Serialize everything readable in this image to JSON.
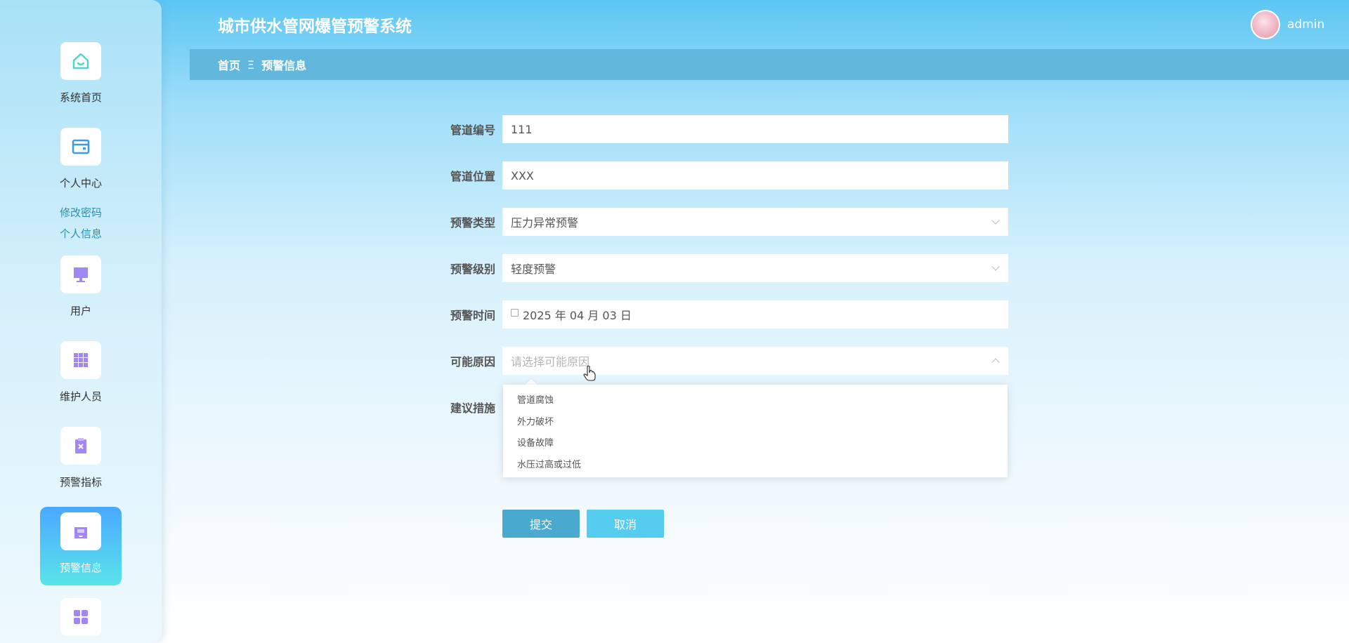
{
  "app": {
    "title": "城市供水管网爆管预警系统"
  },
  "user": {
    "name": "admin"
  },
  "breadcrumb": {
    "home": "首页",
    "separator": "Ξ",
    "current": "预警信息"
  },
  "sidebar": {
    "items": [
      {
        "label": "系统首页",
        "icon": "home-icon"
      },
      {
        "label": "个人中心",
        "icon": "card-icon"
      },
      {
        "label": "用户",
        "icon": "monitor-icon"
      },
      {
        "label": "维护人员",
        "icon": "grid-icon"
      },
      {
        "label": "预警指标",
        "icon": "clipboard-x-icon"
      },
      {
        "label": "预警信息",
        "icon": "inbox-icon",
        "active": true
      },
      {
        "label": "",
        "icon": "apps-icon"
      }
    ],
    "subitems": [
      "修改密码",
      "个人信息"
    ]
  },
  "form": {
    "pipe_no": {
      "label": "管道编号",
      "value": "111"
    },
    "pipe_location": {
      "label": "管道位置",
      "value": "XXX"
    },
    "warning_type": {
      "label": "预警类型",
      "value": "压力异常预警"
    },
    "warning_level": {
      "label": "预警级别",
      "value": "轻度预警"
    },
    "warning_time": {
      "label": "预警时间",
      "value": "2025 年 04 月 03 日"
    },
    "possible_cause": {
      "label": "可能原因",
      "placeholder": "请选择可能原因"
    },
    "suggestion": {
      "label": "建议措施"
    }
  },
  "dropdown": {
    "options": [
      "管道腐蚀",
      "外力破坏",
      "设备故障",
      "水压过高或过低"
    ]
  },
  "buttons": {
    "submit": "提交",
    "cancel": "取消"
  },
  "colors": {
    "accent": "#4aa9ce",
    "cancel": "#54cdef",
    "breadcrumb_bg": "#62b8dc",
    "active_nav": "#4aa8ff"
  }
}
